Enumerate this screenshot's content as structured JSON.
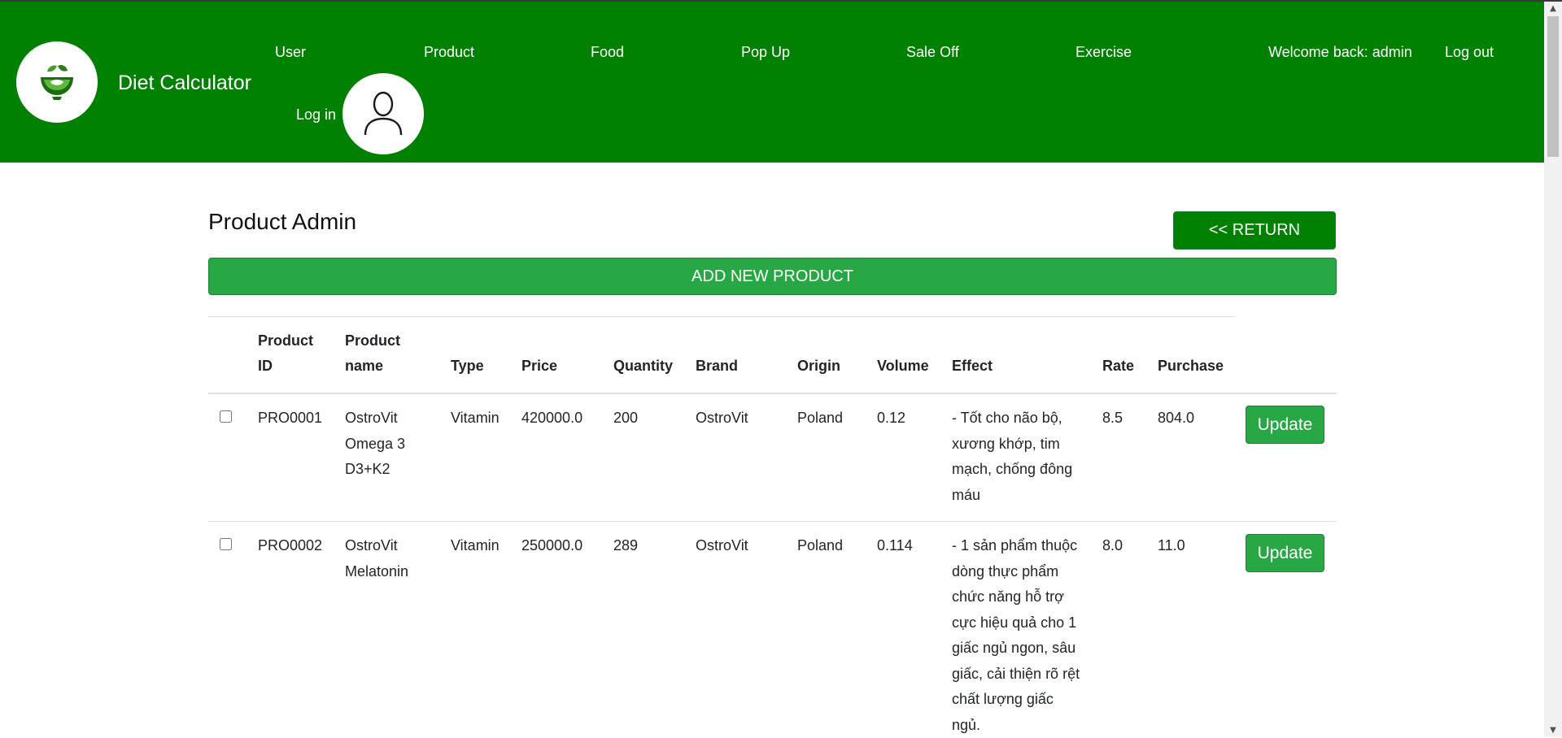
{
  "brand": {
    "name": "Diet Calculator"
  },
  "nav": {
    "items": [
      "User",
      "Product",
      "Food",
      "Pop Up",
      "Sale Off",
      "Exercise"
    ],
    "welcome": "Welcome back: admin",
    "logout": "Log out",
    "login": "Log in"
  },
  "icons": {
    "logo": "salad-bowl-icon",
    "avatar": "user-avatar-icon"
  },
  "colors": {
    "header_bg": "#008000",
    "button_green": "#28a745",
    "return_green": "#008000"
  },
  "page": {
    "title": "Product Admin",
    "return_label": "<< RETURN",
    "add_label": "ADD NEW PRODUCT"
  },
  "table": {
    "headers": {
      "product_id": [
        "Product",
        "ID"
      ],
      "product_name": [
        "Product",
        "name"
      ],
      "type": "Type",
      "price": "Price",
      "quantity": "Quantity",
      "brand": "Brand",
      "origin": "Origin",
      "volume": "Volume",
      "effect": "Effect",
      "rate": "Rate",
      "purchase": "Purchase"
    },
    "update_label": "Update",
    "rows": [
      {
        "id": "PRO0001",
        "name": [
          "OstroVit",
          "Omega 3",
          "D3+K2"
        ],
        "type": "Vitamin",
        "price": "420000.0",
        "quantity": "200",
        "brand": "OstroVit",
        "origin": "Poland",
        "volume": "0.12",
        "effect": [
          "- Tốt cho não bộ,",
          "xương khớp, tim",
          "mạch, chống đông",
          "máu"
        ],
        "rate": "8.5",
        "purchase": "804.0"
      },
      {
        "id": "PRO0002",
        "name": [
          "OstroVit",
          "Melatonin"
        ],
        "type": "Vitamin",
        "price": "250000.0",
        "quantity": "289",
        "brand": "OstroVit",
        "origin": "Poland",
        "volume": "0.114",
        "effect": [
          "- 1 sản phẩm thuộc",
          "dòng thực phẩm",
          "chức năng hỗ trợ",
          "cực hiệu quả cho 1",
          "giấc ngủ ngon, sâu",
          "giấc, cải thiện rõ rệt",
          "chất lượng giấc",
          "ngủ."
        ],
        "rate": "8.0",
        "purchase": "11.0"
      }
    ]
  }
}
